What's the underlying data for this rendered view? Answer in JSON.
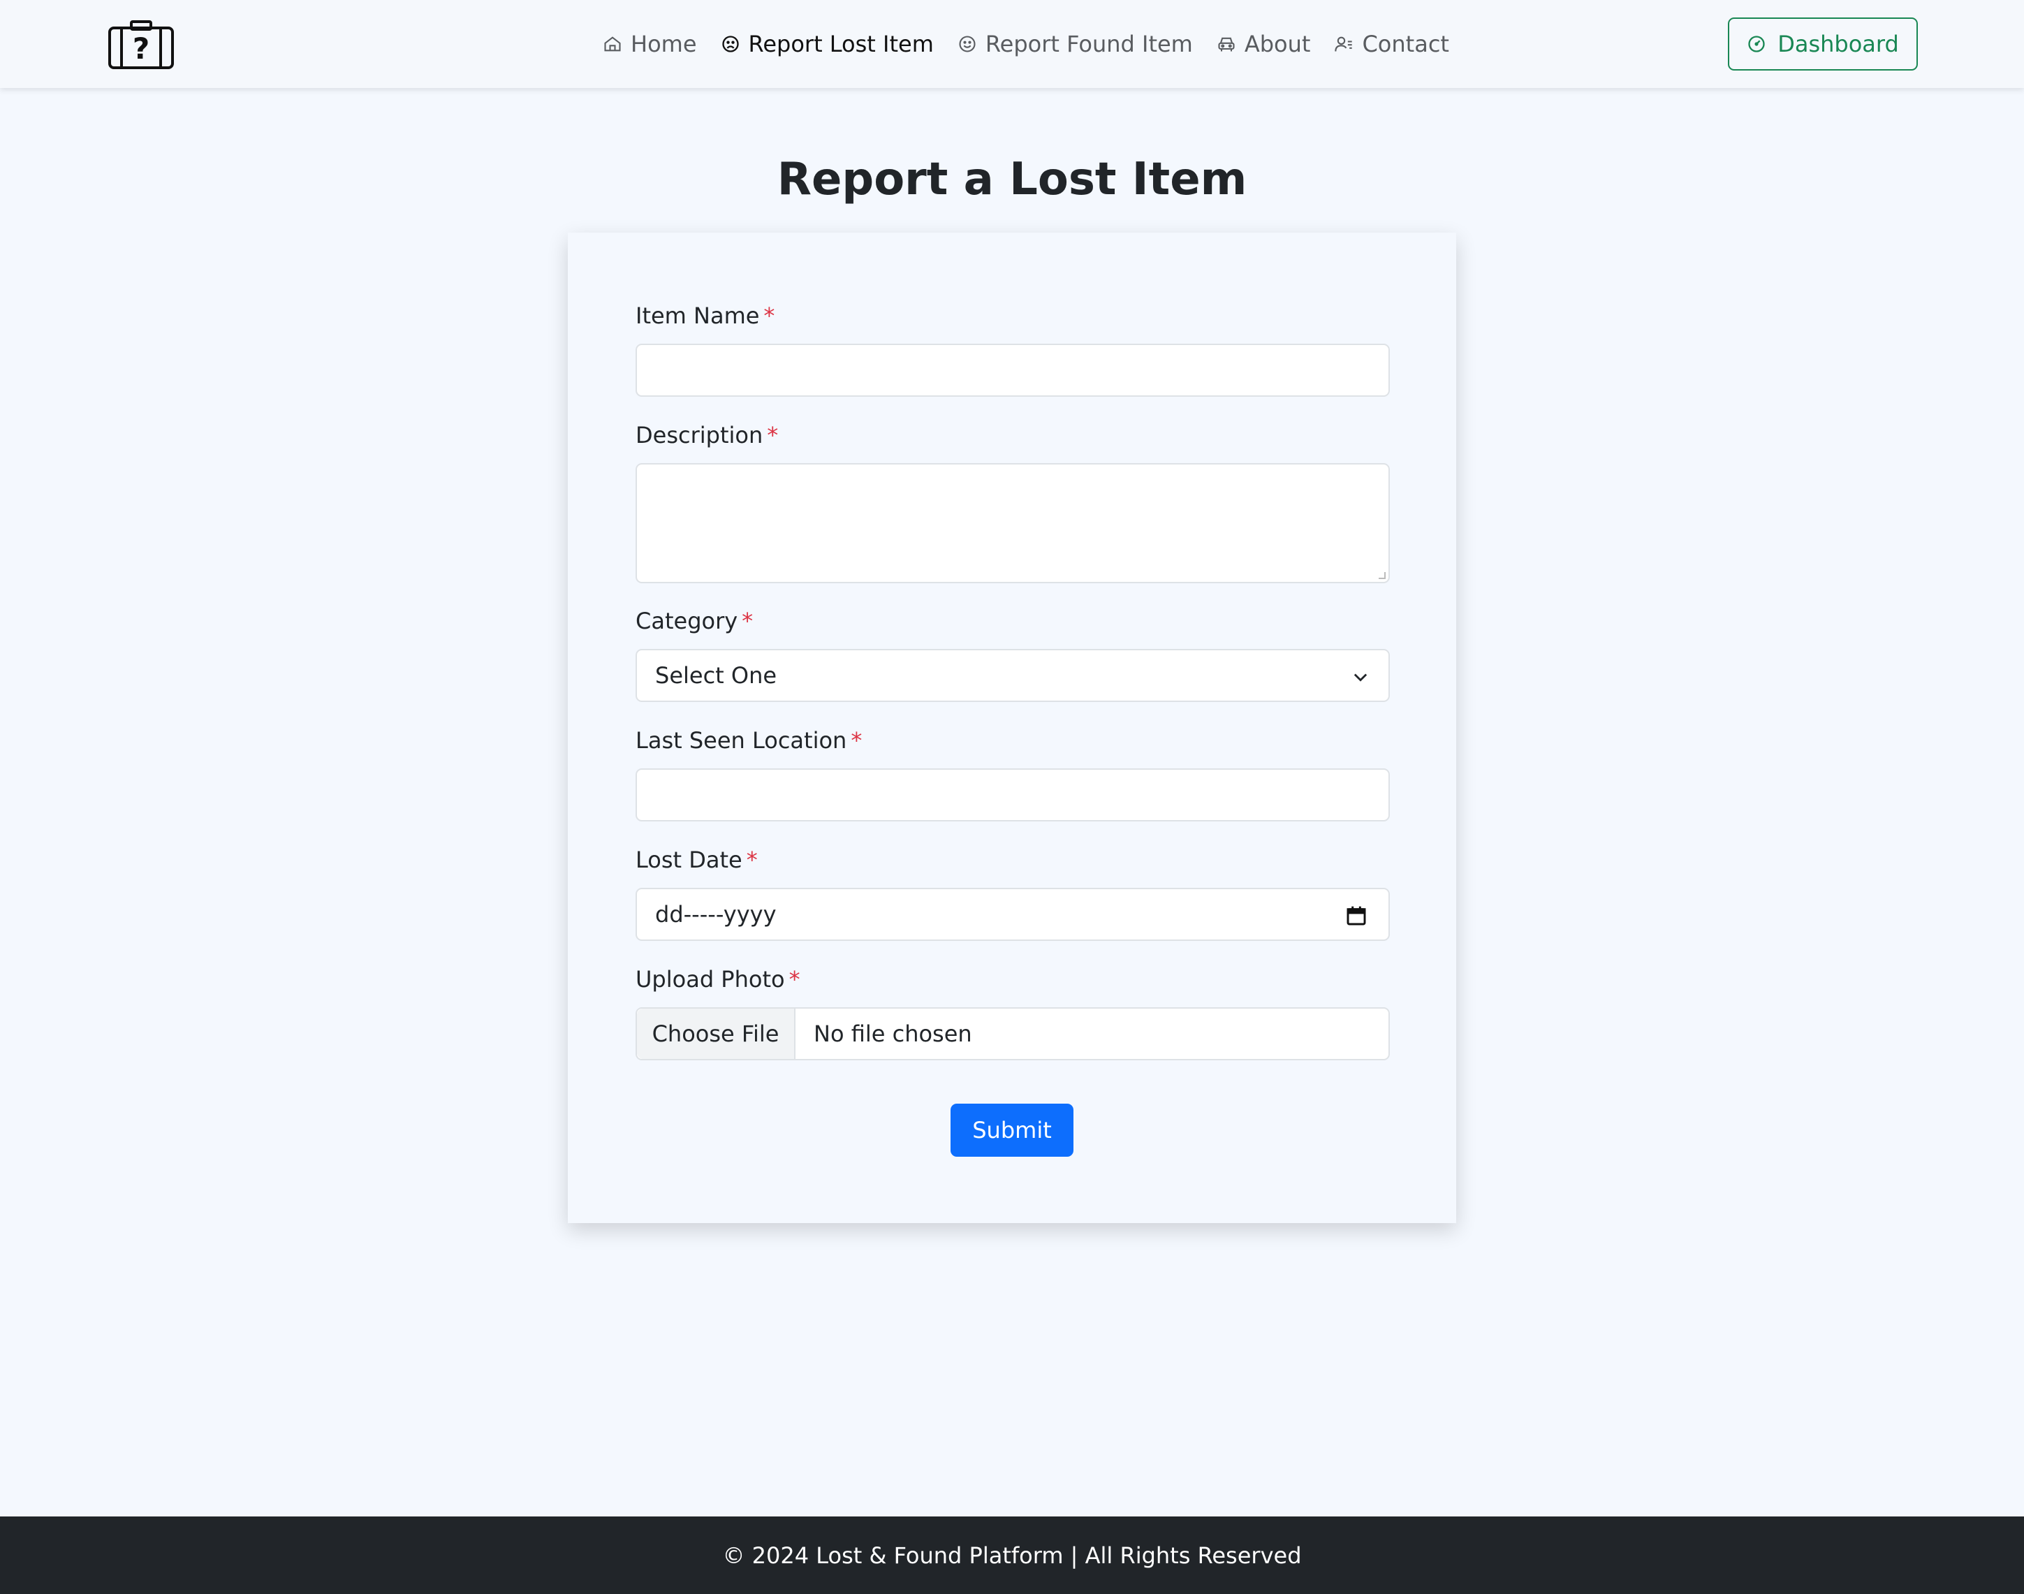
{
  "nav": {
    "brand_icon": "suitcase-question-icon",
    "links": [
      {
        "label": "Home",
        "icon": "home-icon"
      },
      {
        "label": "Report Lost Item",
        "icon": "sad-face-icon",
        "active": true
      },
      {
        "label": "Report Found Item",
        "icon": "smile-face-icon"
      },
      {
        "label": "About",
        "icon": "car-icon"
      },
      {
        "label": "Contact",
        "icon": "contact-icon"
      }
    ],
    "dashboard_label": "Dashboard"
  },
  "page": {
    "title": "Report a Lost Item"
  },
  "form": {
    "required_mark": "*",
    "item_name_label": "Item Name",
    "item_name_value": "",
    "description_label": "Description",
    "description_value": "",
    "category_label": "Category",
    "category_selected": "Select One",
    "location_label": "Last Seen Location",
    "location_value": "",
    "date_label": "Lost Date",
    "date_placeholder": "dd-----yyyy",
    "photo_label": "Upload Photo",
    "file_button": "Choose File",
    "file_status": "No file chosen",
    "submit_label": "Submit"
  },
  "footer": {
    "text": "© 2024 Lost & Found Platform | All Rights Reserved"
  },
  "colors": {
    "accent_primary": "#0d6efd",
    "accent_success": "#198754",
    "required": "#dc3545",
    "footer_bg": "#212529",
    "page_bg": "#f4f8fe"
  }
}
